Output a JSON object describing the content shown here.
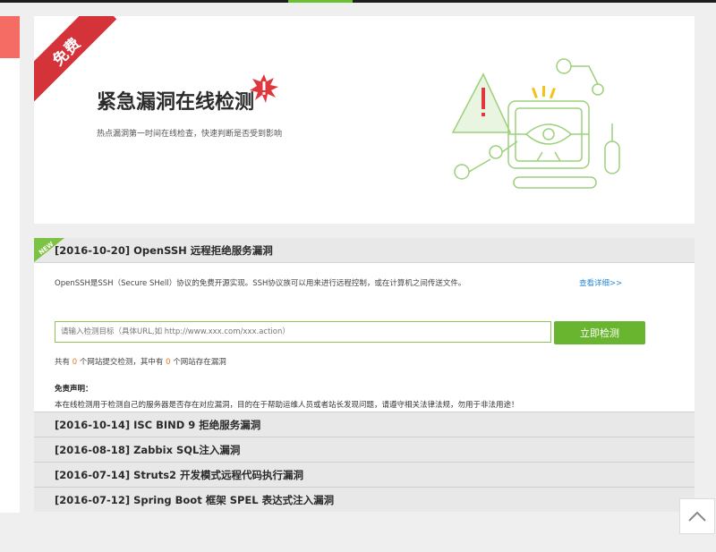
{
  "hero": {
    "ribbon": "免费",
    "title": "紧急漏洞在线检测",
    "subtitle": "热点漏洞第一时间在线检查，快速判断是否受到影响"
  },
  "featured": {
    "badge": "NEW",
    "title": "[2016-10-20] OpenSSH 远程拒绝服务漏洞",
    "description": "OpenSSH是SSH（Secure SHell）协议的免费开源实现。SSH协议族可以用来进行远程控制，或在计算机之间传送文件。",
    "detail_link": "查看详细>>",
    "input_placeholder": "请输入检测目标（具体URL,如 http://www.xxx.com/xxx.action）",
    "check_button": "立即检测",
    "stats": {
      "prefix": "共有",
      "submitted_count": "0",
      "middle": "个网站提交检测，其中有",
      "vulnerable_count": "0",
      "suffix": "个网站存在漏洞"
    },
    "disclaimer_title": "免责声明：",
    "disclaimer_text": "本在线检测用于检测自己的服务器是否存在对应漏洞，目的在于帮助运维人员或者站长发现问题，请遵守相关法律法规，勿用于非法用途！"
  },
  "other_vulns": [
    {
      "title": "[2016-10-14] ISC BIND 9 拒绝服务漏洞"
    },
    {
      "title": "[2016-08-18] Zabbix SQL注入漏洞"
    },
    {
      "title": "[2016-07-14] Struts2 开发模式远程代码执行漏洞"
    },
    {
      "title": "[2016-07-12] Spring Boot 框架 SPEL 表达式注入漏洞"
    }
  ],
  "colors": {
    "accent_green": "#6ab530",
    "ribbon_red": "#d5333a",
    "link_blue": "#2a8ad6",
    "count_orange": "#e07b1f"
  },
  "icons": {
    "scroll_top": "chevron-up-icon",
    "hero_alert": "alert-burst-icon",
    "illustration": "eye-monitor-icon"
  }
}
